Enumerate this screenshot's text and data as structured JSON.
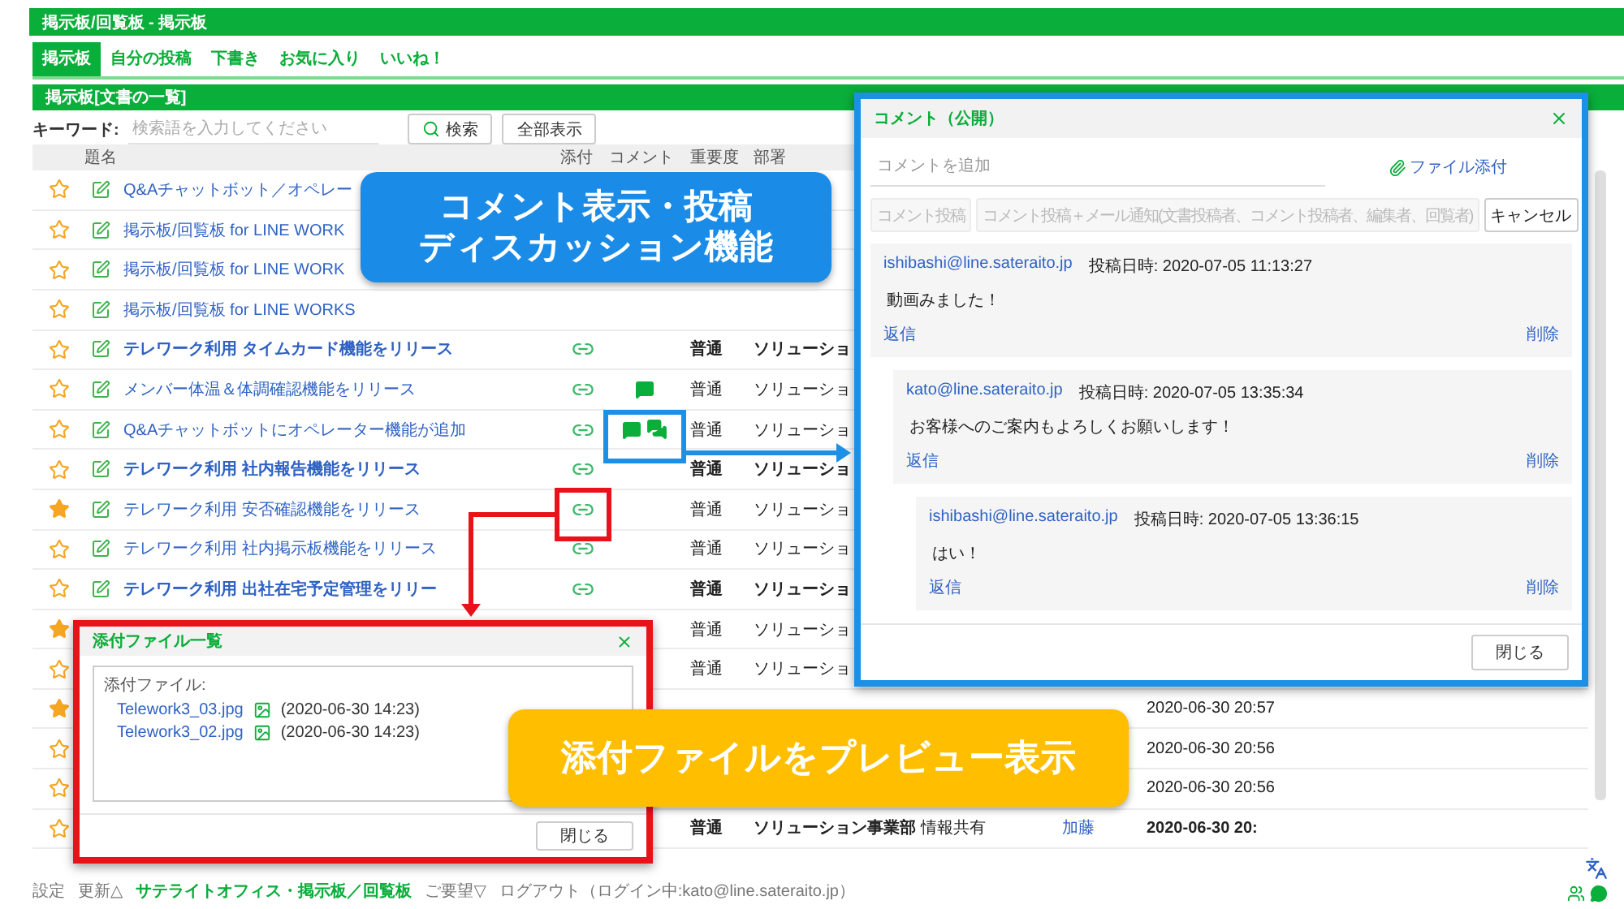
{
  "app_title": "掲示板/回覧板 - 掲示板",
  "tabs": [
    {
      "label": "掲示板",
      "selected": true
    },
    {
      "label": "自分の投稿",
      "selected": false
    },
    {
      "label": "下書き",
      "selected": false
    },
    {
      "label": "お気に入り",
      "selected": false
    },
    {
      "label": "いいね！",
      "selected": false
    }
  ],
  "section_title": "掲示板[文書の一覧]",
  "search": {
    "label": "キーワード:",
    "placeholder": "検索語を入力してください",
    "search_button": "検索",
    "show_all_button": "全部表示"
  },
  "table": {
    "columns": [
      "題名",
      "添付",
      "コメント",
      "重要度",
      "部署"
    ],
    "rows": [
      {
        "favorite": false,
        "editable": true,
        "title": "Q&Aチャットボット／オペレー",
        "emphasized": false
      },
      {
        "favorite": false,
        "editable": true,
        "title": "掲示板/回覧板 for LINE WORK",
        "emphasized": false
      },
      {
        "favorite": false,
        "editable": true,
        "title": "掲示板/回覧板 for LINE WORK",
        "emphasized": false
      },
      {
        "favorite": false,
        "editable": true,
        "title": "掲示板/回覧板 for LINE WORKS",
        "emphasized": false
      },
      {
        "favorite": false,
        "editable": true,
        "title": "テレワーク利用 タイムカード機能をリリース",
        "emphasized": true,
        "attachment": true,
        "importance": "普通",
        "department": "ソリューショ"
      },
      {
        "favorite": false,
        "editable": true,
        "title": "メンバー体温＆体調確認機能をリリース",
        "emphasized": false,
        "attachment": true,
        "comment_icons": [
          {
            "kind": "single"
          }
        ],
        "importance": "普通",
        "department": "ソリューショ"
      },
      {
        "favorite": false,
        "editable": true,
        "title": "Q&Aチャットボットにオペレーター機能が追加",
        "emphasized": false,
        "attachment": true,
        "comment_icons": [
          {
            "kind": "single"
          },
          {
            "kind": "multiple"
          }
        ],
        "importance": "普通",
        "department": "ソリューショ"
      },
      {
        "favorite": false,
        "editable": true,
        "title": "テレワーク利用 社内報告機能をリリース",
        "emphasized": true,
        "attachment": true,
        "importance": "普通",
        "department": "ソリューショ"
      },
      {
        "favorite": true,
        "editable": true,
        "title": "テレワーク利用 安否確認機能をリリース",
        "emphasized": false,
        "attachment": true,
        "importance": "普通",
        "department": "ソリューショ"
      },
      {
        "favorite": false,
        "editable": true,
        "title": "テレワーク利用 社内掲示板機能をリリース",
        "emphasized": false,
        "attachment": true,
        "importance": "普通",
        "department": "ソリューショ"
      },
      {
        "favorite": false,
        "editable": true,
        "title": "テレワーク利用 出社在宅予定管理をリリー",
        "emphasized": true,
        "attachment": true,
        "importance": "普通",
        "department": "ソリューショ"
      },
      {
        "favorite": true,
        "emphasized": false,
        "importance": "普通",
        "department": "ソリューショ"
      },
      {
        "favorite": false,
        "emphasized": false,
        "importance": "普通",
        "department": "ソリューショ"
      },
      {
        "favorite": true,
        "emphasized": false,
        "date": "2020-06-30 20:57"
      },
      {
        "favorite": false,
        "emphasized": false,
        "date": "2020-06-30 20:56"
      },
      {
        "favorite": false,
        "emphasized": false,
        "date": "2020-06-30 20:56"
      },
      {
        "favorite": false,
        "emphasized": true,
        "importance": "普通",
        "department": "ソリューション事業部",
        "category": "情報共有",
        "author": "加藤",
        "date": "2020-06-30 20:"
      }
    ]
  },
  "footer": [
    {
      "label": "設定",
      "highlighted": false
    },
    {
      "label": "更新△",
      "highlighted": false
    },
    {
      "label": "サテライトオフィス・掲示板／回覧板",
      "highlighted": true
    },
    {
      "label": "ご要望▽",
      "highlighted": false
    },
    {
      "label": "ログアウト（ログイン中:kato@line.sateraito.jp）",
      "highlighted": false
    }
  ],
  "comment_dialog": {
    "title": "コメント（公開）",
    "placeholder": "コメントを追加",
    "attach_link": "ファイル添付",
    "buttons": [
      {
        "label": "コメント投稿",
        "disabled": true
      },
      {
        "label": "コメント投稿＋メール通知(文書投稿者、コメント投稿者、編集者、回覧者)",
        "disabled": true
      },
      {
        "label": "キャンセル",
        "disabled": false
      }
    ],
    "comments": [
      {
        "author": "ishibashi@line.sateraito.jp",
        "posted": "投稿日時: 2020-07-05 11:13:27",
        "body": "動画みました！",
        "reply": "返信",
        "delete": "削除",
        "children": [
          {
            "author": "kato@line.sateraito.jp",
            "posted": "投稿日時: 2020-07-05 13:35:34",
            "body": "お客様へのご案内もよろしくお願いします！",
            "reply": "返信",
            "delete": "削除",
            "children": [
              {
                "author": "ishibashi@line.sateraito.jp",
                "posted": "投稿日時: 2020-07-05 13:36:15",
                "body": "はい！",
                "reply": "返信",
                "delete": "削除"
              }
            ]
          }
        ]
      }
    ],
    "close_button": "閉じる"
  },
  "attachment_dialog": {
    "title": "添付ファイル一覧",
    "label": "添付ファイル:",
    "files": [
      {
        "name": "Telework3_03.jpg",
        "date": "(2020-06-30 14:23)"
      },
      {
        "name": "Telework3_02.jpg",
        "date": "(2020-06-30 14:23)"
      }
    ],
    "close_button": "閉じる"
  },
  "callouts": [
    {
      "lines": [
        "コメント表示・投稿",
        "ディスカッション機能"
      ],
      "color": "#1a8ce8"
    },
    {
      "lines": [
        "添付ファイルをプレビュー表示"
      ],
      "color": "#ffbe00"
    }
  ]
}
